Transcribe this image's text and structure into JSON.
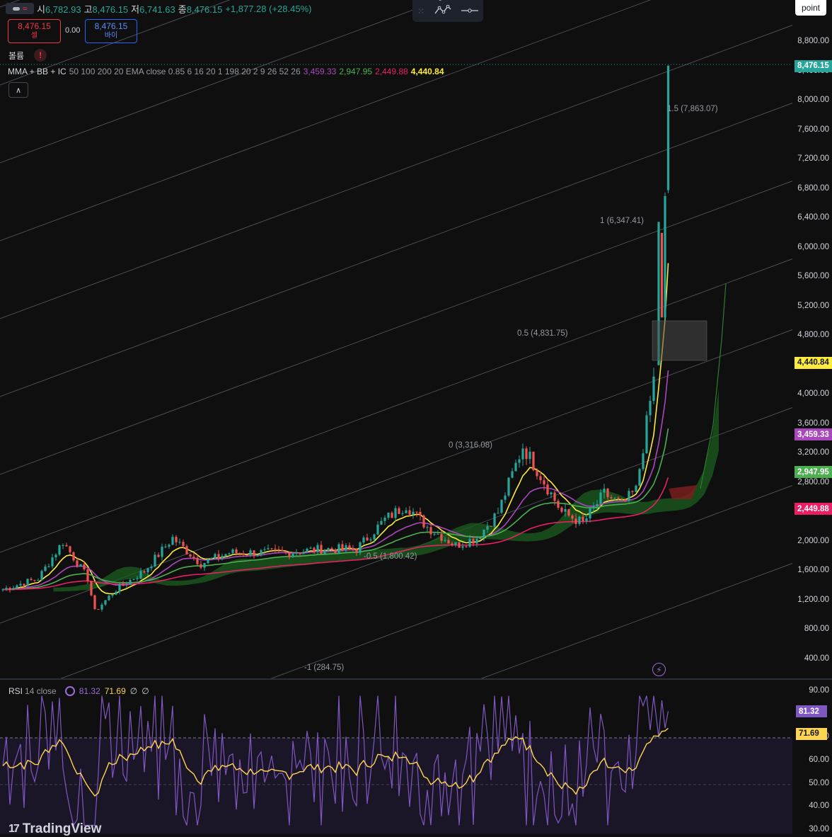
{
  "header": {
    "ohlc": [
      {
        "key": "시",
        "value": "6,782.93"
      },
      {
        "key": "고",
        "value": "8,476.15"
      },
      {
        "key": "저",
        "value": "6,741.63"
      },
      {
        "key": "종",
        "value": "8,476.15"
      }
    ],
    "change": "+1,877.28 (+28.45%)"
  },
  "trade": {
    "sell_price": "8,476.15",
    "sell_label": "셀",
    "spread": "0.00",
    "buy_price": "8,476.15",
    "buy_label": "바이"
  },
  "volume": {
    "label": "볼륨",
    "warning": "!"
  },
  "indicator": {
    "name": "MMA + BB + IC",
    "params": "50 100 200 20 EMA close 0.85 6 16 20 1 198 20 2 9 26 52 26",
    "values": [
      {
        "value": "3,459.33",
        "color": "#ab47bc"
      },
      {
        "value": "2,947.95",
        "color": "#4caf50"
      },
      {
        "value": "2,449.88",
        "color": "#e91e63"
      },
      {
        "value": "4,440.84",
        "color": "#ffeb3b"
      }
    ],
    "collapse_icon": "chevron-up-icon"
  },
  "toolbar": {
    "drawing_icon": "line-chart-icon",
    "drawing_marks": [
      "1",
      "5"
    ],
    "line_icon": "horizontal-line-icon"
  },
  "point_button": "point",
  "price_axis": {
    "labels": [
      "8,800.00",
      "8,400.00",
      "8,000.00",
      "7,600.00",
      "7,200.00",
      "6,800.00",
      "6,400.00",
      "6,000.00",
      "5,600.00",
      "5,200.00",
      "4,800.00",
      "4,400.00",
      "4,000.00",
      "3,600.00",
      "3,200.00",
      "2,800.00",
      "2,400.00",
      "2,000.00",
      "1,600.00",
      "1,200.00",
      "800.00",
      "400.00"
    ],
    "tags": [
      {
        "text": "8,476.15",
        "bg": "#26a69a",
        "fg": "#ffffff"
      },
      {
        "text": "4,440.84",
        "bg": "#ffeb3b",
        "fg": "#131722"
      },
      {
        "text": "3,459.33",
        "bg": "#ab47bc",
        "fg": "#ffffff"
      },
      {
        "text": "2,947.95",
        "bg": "#4caf50",
        "fg": "#ffffff"
      },
      {
        "text": "2,449.88",
        "bg": "#e91e63",
        "fg": "#ffffff"
      }
    ]
  },
  "fib_labels": [
    "1.5 (7,863.07)",
    "1 (6,347.41)",
    "0.5 (4,831.75)",
    "0 (3,316.08)",
    "-0.5 (1,800.42)",
    "-1 (284.75)"
  ],
  "rsi": {
    "label": "RSI",
    "params": "14 close",
    "value": "81.32",
    "ma_value": "71.69",
    "value_color": "#7e57c2",
    "ma_color": "#ffd54f",
    "hidden_icons": [
      "∅",
      "∅"
    ],
    "cycle_icon": "cycle-icon",
    "axis": [
      "90.00",
      "70.00",
      "60.00",
      "50.00",
      "40.00",
      "30.00"
    ],
    "tags": [
      {
        "text": "81.32",
        "bg": "#7e57c2",
        "fg": "#ffffff"
      },
      {
        "text": "71.69",
        "bg": "#ffd54f",
        "fg": "#131722"
      }
    ]
  },
  "brand": {
    "name": "TradingView",
    "mark": "17"
  },
  "colors": {
    "up": "#26a69a",
    "down": "#ef5350",
    "bg": "#0f0f0f"
  }
}
